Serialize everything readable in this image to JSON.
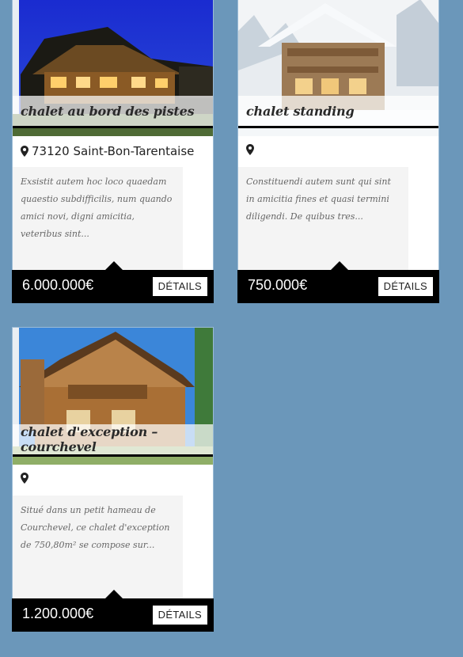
{
  "colors": {
    "page_background": "#6b97ba",
    "price_bar": "#000000",
    "title_band": "#ffffff"
  },
  "listings": [
    {
      "title": "chalet au bord des pistes",
      "address": "73120 Saint-Bon-Tarentaise",
      "description": "Exsistit autem hoc loco quaedam quaestio subdifficilis, num quando amici novi, digni amicitia, veteribus sint...",
      "price": "6.000.000€",
      "details_label": "DÉTAILS",
      "icon": "map-marker-icon"
    },
    {
      "title": "chalet standing",
      "address": "",
      "description": "Constituendi autem sunt qui sint in amicitia fines et quasi termini diligendi. De quibus tres...",
      "price": "750.000€",
      "details_label": "DÉTAILS",
      "icon": "map-marker-icon"
    },
    {
      "title": "chalet d'exception – courchevel",
      "address": "",
      "description": "Situé dans un petit hameau de Courchevel, ce chalet d'exception de 750,80m² se compose sur...",
      "price": "1.200.000€",
      "details_label": "DÉTAILS",
      "icon": "map-marker-icon"
    }
  ]
}
